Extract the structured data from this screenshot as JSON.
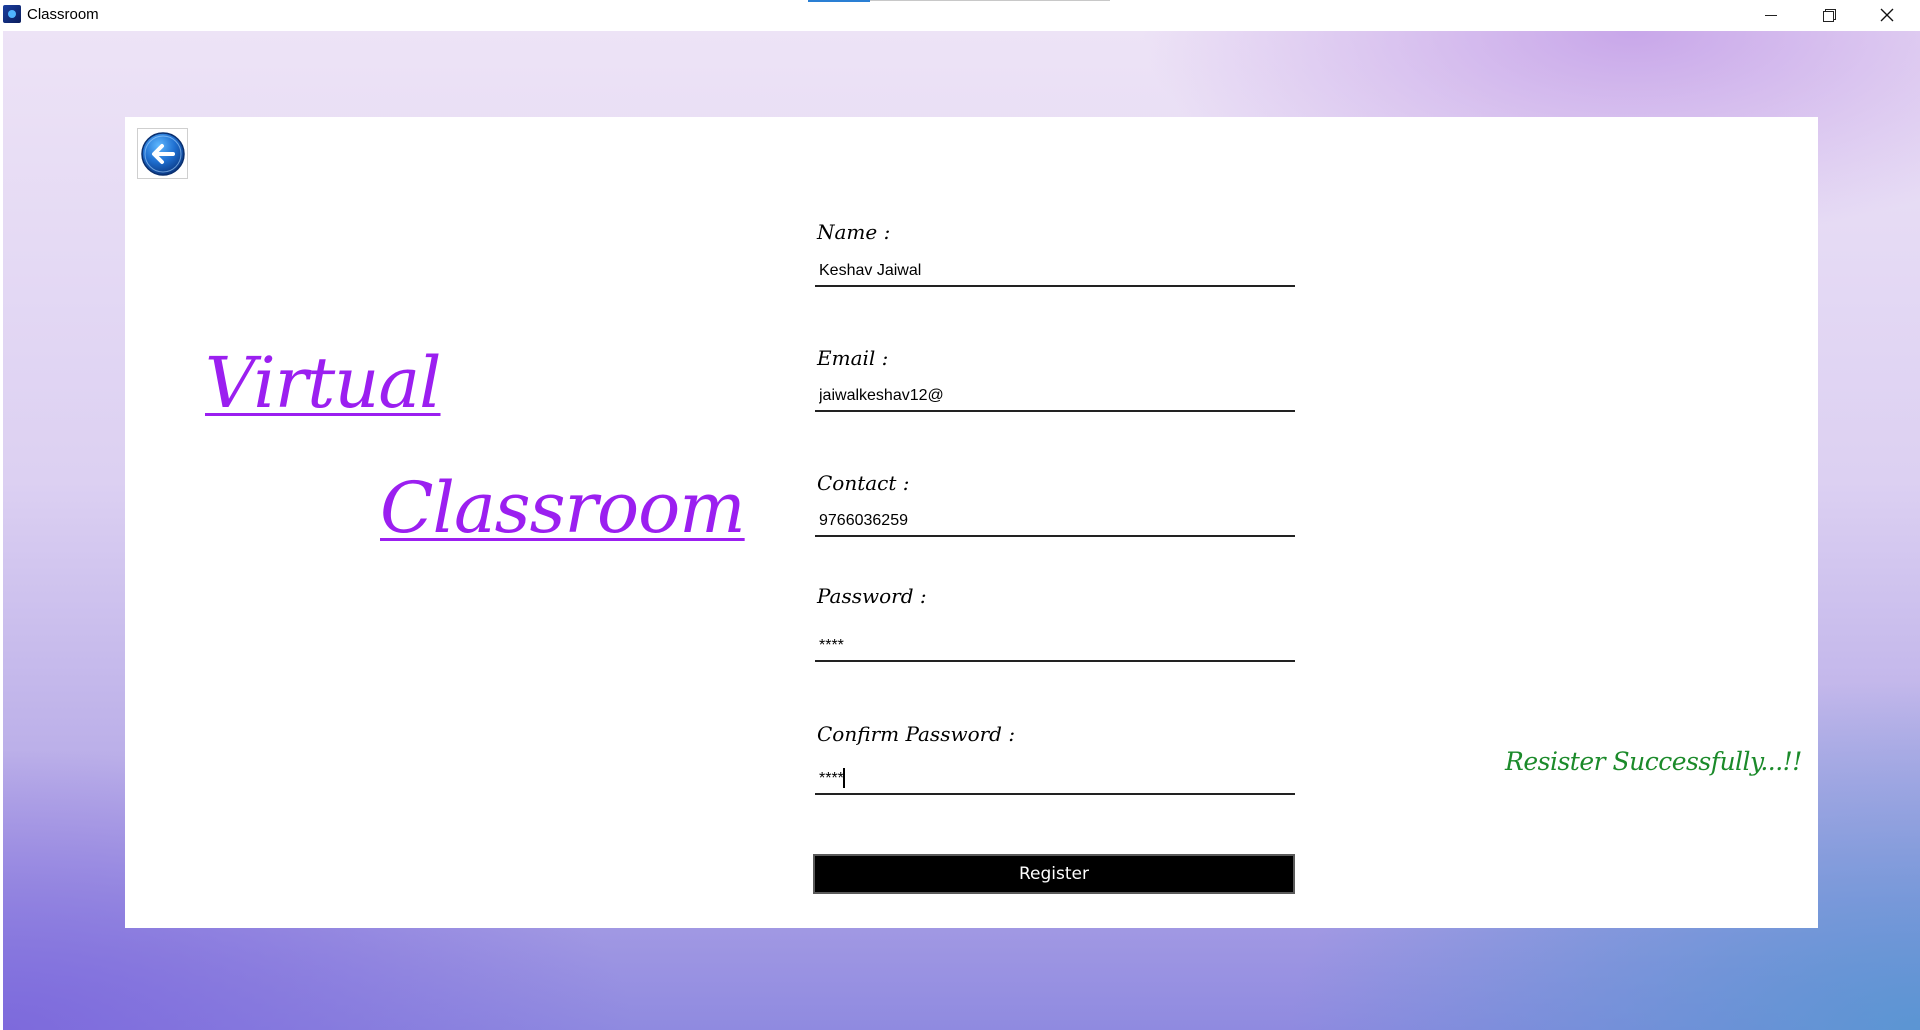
{
  "window": {
    "title": "Classroom",
    "icon": "app-icon"
  },
  "brand": {
    "line1": "Virtual",
    "line2": "Classroom",
    "color": "#9b1ff0"
  },
  "form": {
    "name": {
      "label": "Name :",
      "value": "Keshav Jaiwal"
    },
    "email": {
      "label": "Email :",
      "value": "jaiwalkeshav12@"
    },
    "contact": {
      "label": "Contact :",
      "value": "9766036259"
    },
    "password": {
      "label": "Password :",
      "value": "****"
    },
    "confirm_password": {
      "label": "Confirm Password :",
      "value": "****"
    },
    "register_label": "Register"
  },
  "status": {
    "message": "Resister Successfully...!!",
    "color": "#1b8a2a"
  },
  "icons": {
    "back": "back-arrow-icon",
    "minimize": "minimize-icon",
    "restore": "restore-icon",
    "close": "close-icon"
  }
}
